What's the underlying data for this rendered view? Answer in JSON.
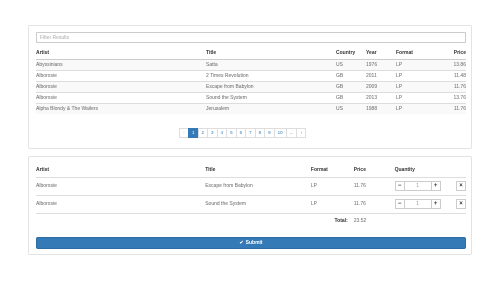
{
  "search": {
    "placeholder": "Filter Results",
    "value": ""
  },
  "results": {
    "headers": {
      "artist": "Artist",
      "title": "Title",
      "country": "Country",
      "year": "Year",
      "format": "Format",
      "price": "Price"
    },
    "rows": [
      {
        "artist": "Abyssinians",
        "title": "Satta",
        "country": "US",
        "year": "1976",
        "format": "LP",
        "price": "13.86"
      },
      {
        "artist": "Alborosie",
        "title": "2 Times Revolution",
        "country": "GB",
        "year": "2011",
        "format": "LP",
        "price": "11.48"
      },
      {
        "artist": "Alborosie",
        "title": "Escape from Babylon",
        "country": "GB",
        "year": "2009",
        "format": "LP",
        "price": "11.76"
      },
      {
        "artist": "Alborosie",
        "title": "Sound the System",
        "country": "GB",
        "year": "2013",
        "format": "LP",
        "price": "13.76"
      },
      {
        "artist": "Alpha Blondy & The Wailers",
        "title": "Jerusalem",
        "country": "US",
        "year": "1988",
        "format": "LP",
        "price": "11.76"
      }
    ]
  },
  "pagination": {
    "prev": "‹",
    "pages": [
      "1",
      "2",
      "3",
      "4",
      "5",
      "6",
      "7",
      "8",
      "9",
      "10"
    ],
    "ellipsis": "...",
    "next": "›",
    "active_page": "1"
  },
  "cart": {
    "headers": {
      "artist": "Artist",
      "title": "Title",
      "format": "Format",
      "price": "Price",
      "quantity": "Quantity"
    },
    "rows": [
      {
        "artist": "Alborosie",
        "title": "Escape from Babylon",
        "format": "LP",
        "price": "11.76",
        "quantity": "1"
      },
      {
        "artist": "Alborosie",
        "title": "Sound the System",
        "format": "LP",
        "price": "11.76",
        "quantity": "1"
      }
    ],
    "total_label": "Total:",
    "total_value": "23.52",
    "minus_label": "−",
    "plus_label": "+",
    "remove_label": "×"
  },
  "submit": {
    "label": "Submit",
    "icon": "check-icon",
    "color": "#337ab7"
  }
}
